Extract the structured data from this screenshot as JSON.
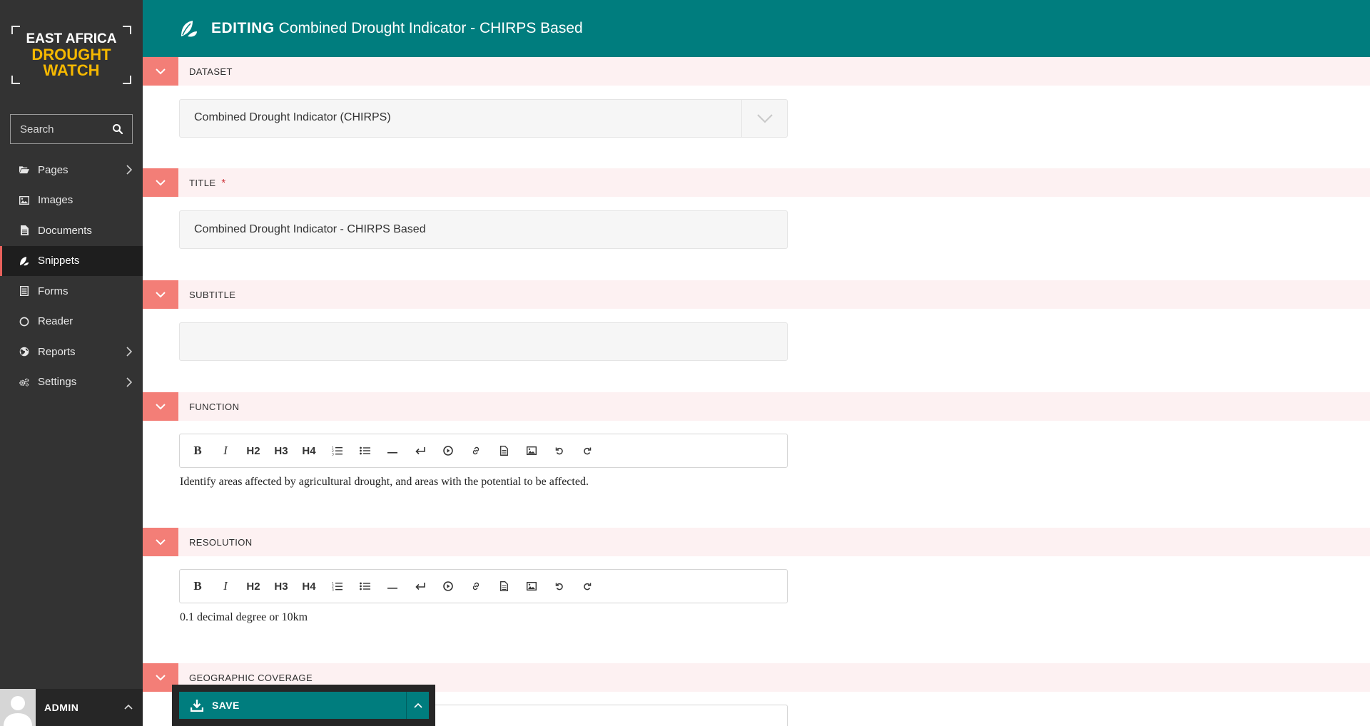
{
  "brand": {
    "line1": "EAST AFRICA",
    "line2": "DROUGHT",
    "line3": "WATCH"
  },
  "search": {
    "placeholder": "Search"
  },
  "nav": [
    {
      "label": "Pages",
      "icon": "folder-open-icon",
      "has_submenu": true
    },
    {
      "label": "Images",
      "icon": "image-icon",
      "has_submenu": false
    },
    {
      "label": "Documents",
      "icon": "document-icon",
      "has_submenu": false
    },
    {
      "label": "Snippets",
      "icon": "snippet-leaf-icon",
      "has_submenu": false,
      "active": true
    },
    {
      "label": "Forms",
      "icon": "form-list-icon",
      "has_submenu": false
    },
    {
      "label": "Reader",
      "icon": "circle-icon",
      "has_submenu": false
    },
    {
      "label": "Reports",
      "icon": "globe-icon",
      "has_submenu": true
    },
    {
      "label": "Settings",
      "icon": "cogs-icon",
      "has_submenu": true
    }
  ],
  "account": {
    "name": "ADMIN"
  },
  "header": {
    "action": "EDITING",
    "title": "Combined Drought Indicator - CHIRPS Based"
  },
  "sections": {
    "dataset": {
      "label": "DATASET",
      "value": "Combined Drought Indicator (CHIRPS)"
    },
    "title": {
      "label": "TITLE",
      "required_mark": "*",
      "value": "Combined Drought Indicator - CHIRPS Based"
    },
    "subtitle": {
      "label": "SUBTITLE",
      "value": ""
    },
    "function": {
      "label": "FUNCTION",
      "text": "Identify areas affected by agricultural drought, and areas with the potential to be affected."
    },
    "resolution": {
      "label": "RESOLUTION",
      "text": "0.1 decimal degree or 10km"
    },
    "geographic": {
      "label": "GEOGRAPHIC COVERAGE"
    }
  },
  "toolbar": {
    "bold": "B",
    "italic": "I",
    "h2": "H2",
    "h3": "H3",
    "h4": "H4"
  },
  "save": {
    "label": "SAVE"
  },
  "colors": {
    "header": "#007d7e",
    "sidebar": "#333333",
    "toggle": "#f37e77",
    "section_bg": "#fdf1f2",
    "brand_yellow": "#f5b800"
  }
}
